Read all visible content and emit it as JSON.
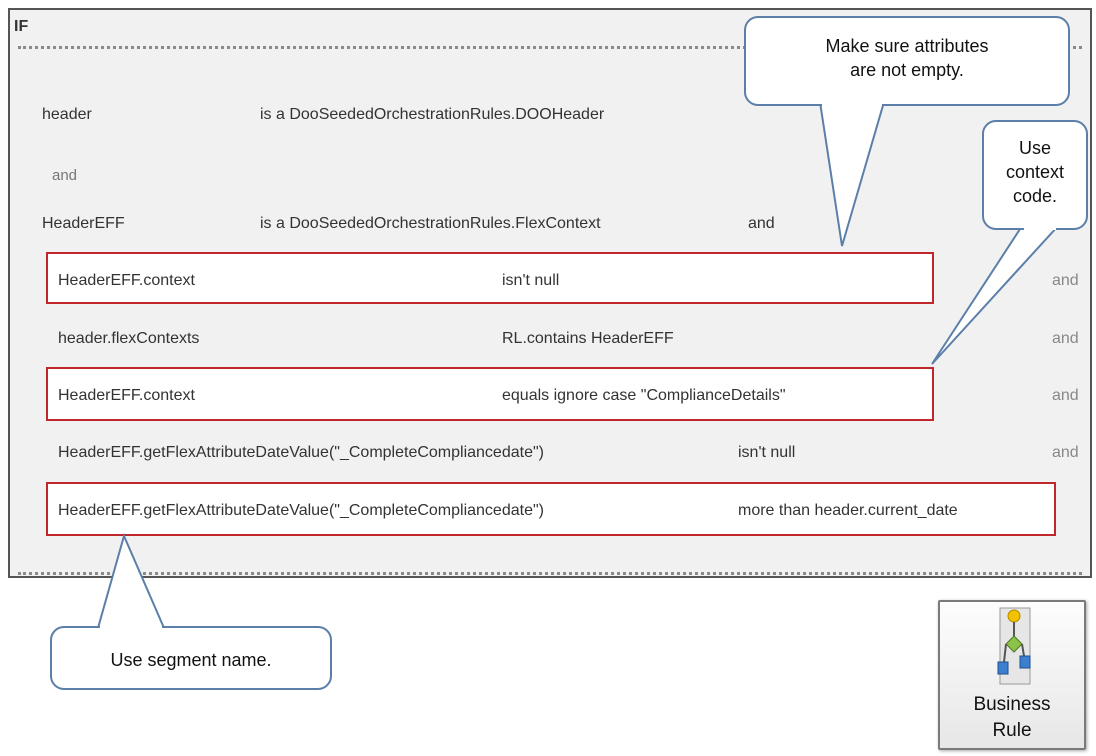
{
  "panel": {
    "if_label": "IF",
    "rows": {
      "r1": {
        "left": "header",
        "right": "is a DooSeededOrchestrationRules.DOOHeader"
      },
      "r1_and": "and",
      "r2": {
        "left": "HeaderEFF",
        "right": "is a DooSeededOrchestrationRules.FlexContext",
        "and": "and"
      },
      "r3": {
        "left": "HeaderEFF.context",
        "right": "isn't null",
        "and": "and"
      },
      "r4": {
        "left": "header.flexContexts",
        "right": "RL.contains HeaderEFF",
        "and": "and"
      },
      "r5": {
        "left": "HeaderEFF.context",
        "right": "equals ignore case \"ComplianceDetails\"",
        "and": "and"
      },
      "r6": {
        "left": "HeaderEFF.getFlexAttributeDateValue(\"_CompleteCompliancedate\")",
        "right": "isn't null",
        "and": "and"
      },
      "r7": {
        "left": "HeaderEFF.getFlexAttributeDateValue(\"_CompleteCompliancedate\")",
        "right": "more than header.current_date"
      }
    }
  },
  "callouts": {
    "attributes": {
      "line1": "Make sure attributes",
      "line2": "are not empty."
    },
    "context": {
      "line1": "Use",
      "line2": "context",
      "line3": "code."
    },
    "segment": {
      "line1": "Use segment name."
    }
  },
  "business_rule": {
    "line1": "Business",
    "line2": "Rule",
    "icon": "business-rule-icon"
  },
  "colors": {
    "highlight": "#c0272d",
    "callout_border": "#5b7fa8",
    "panel_bg": "#f1f1f1"
  }
}
